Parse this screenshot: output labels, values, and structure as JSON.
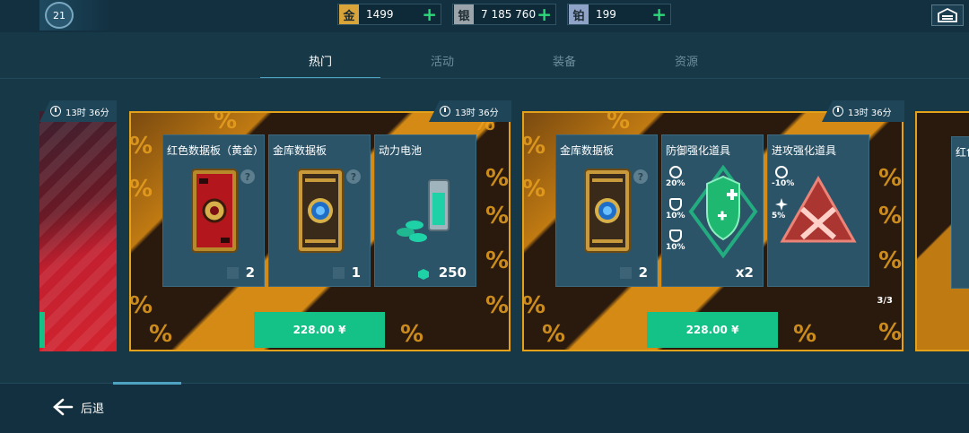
{
  "player": {
    "level": "21"
  },
  "currencies": [
    {
      "icon": "金",
      "value": "1499",
      "color": "#d9a53a"
    },
    {
      "icon": "银",
      "value": "7 185 760",
      "color": "#9aa4aa"
    },
    {
      "icon": "铂",
      "value": "199",
      "color": "#8fa2c8"
    }
  ],
  "tabs": [
    "热门",
    "活动",
    "装备",
    "资源"
  ],
  "offers": [
    {
      "timer": "13时 36分",
      "price": "228.00 ¥",
      "items": [
        {
          "name": "红色数据板（黄金）",
          "qty": "2"
        },
        {
          "name": "金库数据板",
          "qty": "1"
        },
        {
          "name": "动力电池",
          "qty": "250"
        }
      ]
    },
    {
      "timer": "13时 36分",
      "price": "228.00 ¥",
      "page": "3/3",
      "items": [
        {
          "name": "金库数据板",
          "qty": "2"
        },
        {
          "name": "防御强化道具",
          "qty": "x2",
          "stats": [
            "20%",
            "10%",
            "10%"
          ]
        },
        {
          "name": "进攻强化道具",
          "stats": [
            "-10%",
            "5%"
          ]
        }
      ]
    }
  ],
  "left_offer": {
    "timer": "13时 36分"
  },
  "right_offer": {
    "item_name": "红色"
  },
  "footer": {
    "back_label": "后退"
  }
}
